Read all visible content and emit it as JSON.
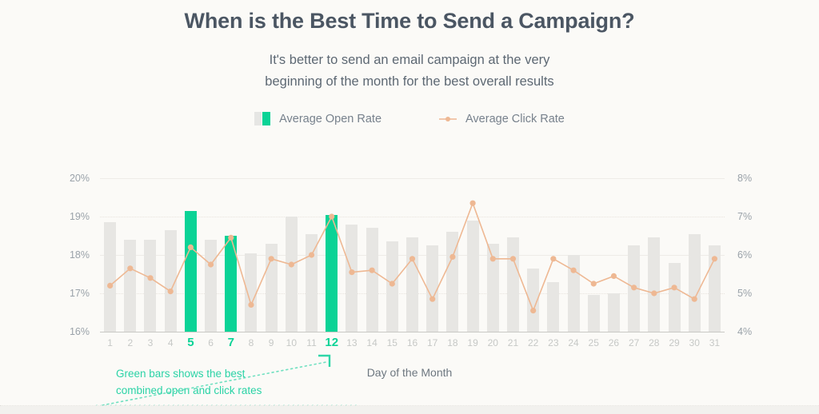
{
  "header": {
    "title": "When is the Best Time to Send a Campaign?",
    "subtitle_line1": "It's better to send an email campaign at the very",
    "subtitle_line2": "beginning of the month for the best overall results"
  },
  "legend": {
    "items": [
      {
        "label": "Average Open Rate",
        "type": "bar",
        "color_gray": "#e6e6e4",
        "color_green": "#0ad396"
      },
      {
        "label": "Average Click Rate",
        "type": "line",
        "color": "#eeb893"
      }
    ]
  },
  "annotation": {
    "line1": "Green bars shows the best",
    "line2": "combined open and click rates",
    "color": "#2ad3a6"
  },
  "axis": {
    "x_title": "Day of the Month",
    "y_left_ticks": [
      "20%",
      "19%",
      "18%",
      "17%",
      "16%"
    ],
    "y_right_ticks": [
      "8%",
      "7%",
      "6%",
      "5%",
      "4%"
    ]
  },
  "chart_data": {
    "type": "bar",
    "title": "When is the Best Time to Send a Campaign?",
    "subtitle": "It's better to send an email campaign at the very beginning of the month for the best overall results",
    "xlabel": "Day of the Month",
    "ylabel": "Average Open Rate",
    "ylabel_secondary": "Average Click Rate",
    "ylim": [
      16,
      20
    ],
    "ylim_secondary": [
      4,
      8
    ],
    "grid": true,
    "legend_position": "top-center",
    "highlight_color": "#0ad396",
    "bar_color": "#e7e6e3",
    "line_color": "#eeb893",
    "highlighted_days": [
      5,
      7,
      12
    ],
    "categories": [
      1,
      2,
      3,
      4,
      5,
      6,
      7,
      8,
      9,
      10,
      11,
      12,
      13,
      14,
      15,
      16,
      17,
      18,
      19,
      20,
      21,
      22,
      23,
      24,
      25,
      26,
      27,
      28,
      29,
      30,
      31
    ],
    "series": [
      {
        "name": "Average Open Rate",
        "axis": "left",
        "unit": "%",
        "values": [
          18.85,
          18.4,
          18.4,
          18.65,
          19.15,
          18.4,
          18.5,
          18.05,
          18.3,
          19.0,
          18.55,
          19.05,
          18.8,
          18.7,
          18.35,
          18.45,
          18.25,
          18.6,
          18.9,
          18.3,
          18.45,
          17.65,
          17.3,
          18.0,
          16.95,
          17.0,
          18.25,
          18.45,
          17.8,
          18.55,
          18.25
        ]
      },
      {
        "name": "Average Click Rate",
        "axis": "right",
        "unit": "%",
        "values": [
          5.2,
          5.65,
          5.4,
          5.05,
          6.2,
          5.75,
          6.45,
          4.7,
          5.9,
          5.75,
          6.0,
          7.0,
          5.55,
          5.6,
          5.25,
          5.9,
          4.85,
          5.95,
          7.35,
          5.9,
          5.9,
          4.55,
          5.9,
          5.6,
          5.25,
          5.45,
          5.15,
          5.0,
          5.15,
          4.85,
          5.9
        ]
      }
    ]
  }
}
